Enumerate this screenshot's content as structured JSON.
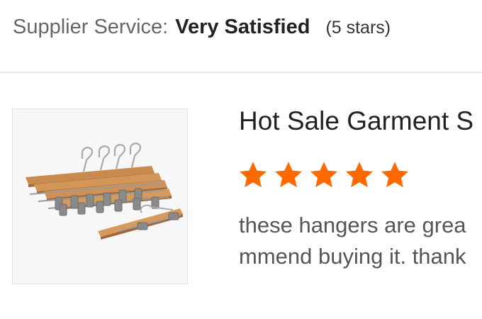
{
  "supplier": {
    "label": "Supplier Service:",
    "value": "Very Satisfied",
    "stars_text": "(5 stars)"
  },
  "product": {
    "title": "Hot Sale Garment S",
    "rating": 5,
    "rating_max": 5,
    "star_color": "#ff6a00",
    "thumbnail_icon": "wooden-hangers-product-photo"
  },
  "review": {
    "line1": "these hangers are grea",
    "line2": "mmend buying it. thank"
  }
}
